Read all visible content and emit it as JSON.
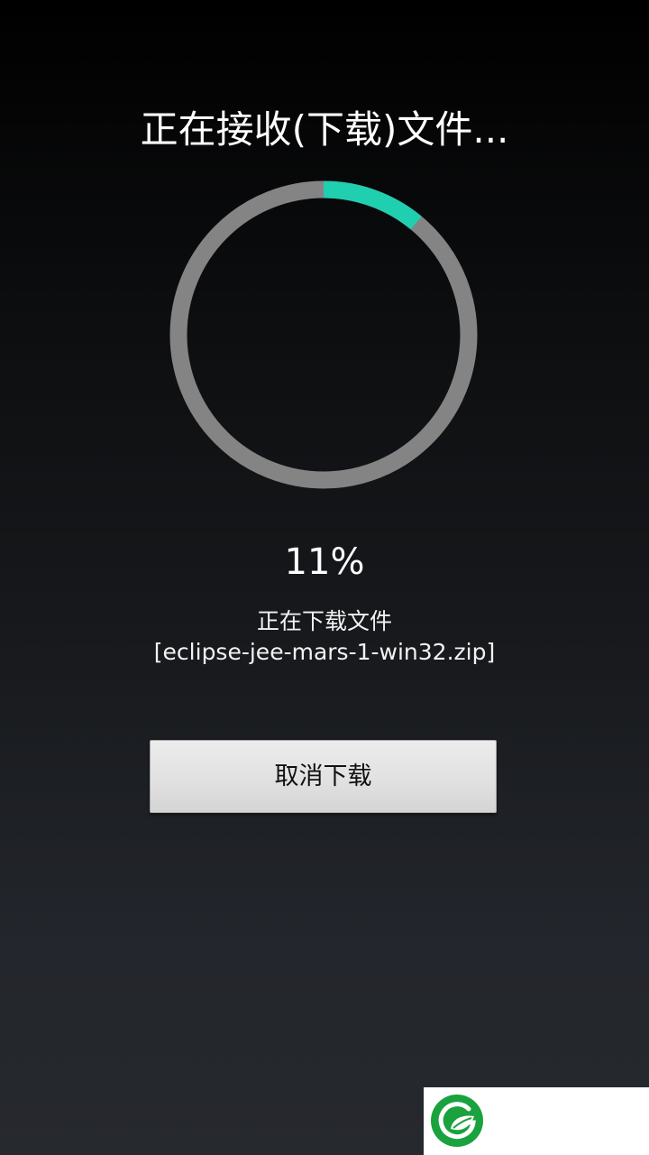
{
  "header": {
    "title": "正在接收(下载)文件..."
  },
  "progress": {
    "value": 0.11,
    "percent_label": "11%",
    "track_color": "#848484",
    "fill_color": "#1fcfb0"
  },
  "status": {
    "line1": "正在下载文件",
    "line2": "[eclipse-jee-mars-1-win32.zip]"
  },
  "actions": {
    "cancel_label": "取消下载"
  },
  "branding": {
    "logo_icon": "green-leaf-logo-icon",
    "logo_color": "#19a23d"
  }
}
